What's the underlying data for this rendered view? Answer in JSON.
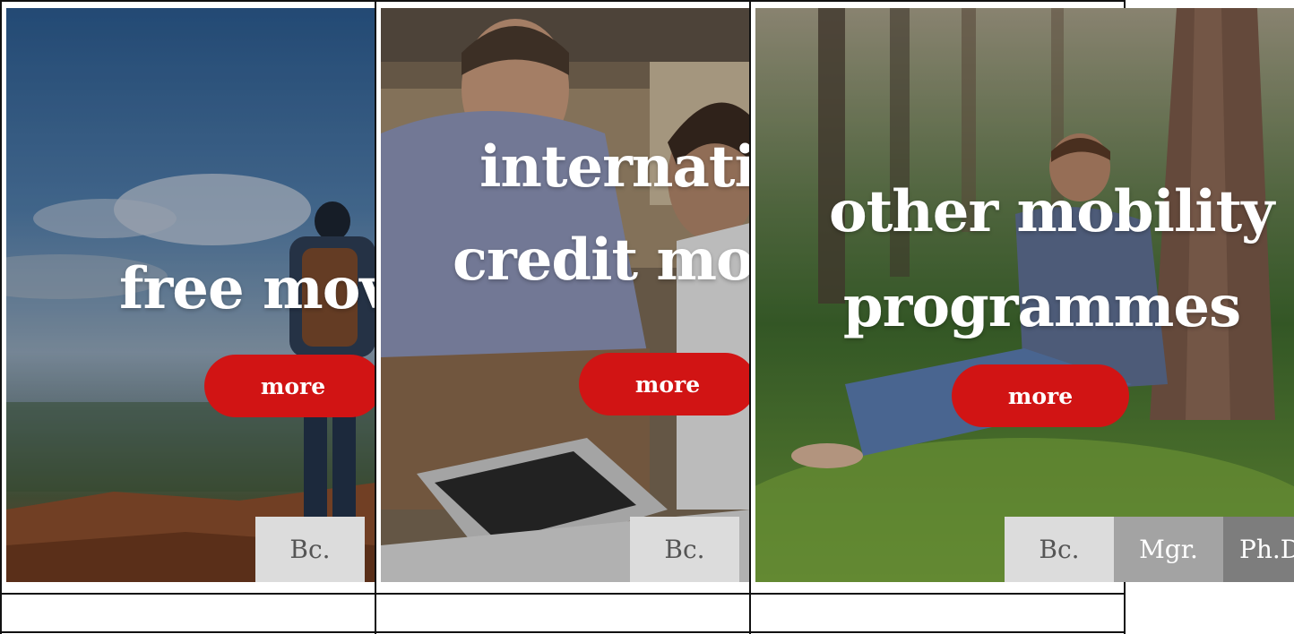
{
  "colors": {
    "accent": "#d11414",
    "tab_bc": "#dcdcdc",
    "tab_mgr": "#a3a3a3",
    "tab_phd": "#7d7d7d"
  },
  "cards": [
    {
      "title_lines": [
        "free mov"
      ],
      "more_label": "more",
      "tabs": [
        "Bc."
      ]
    },
    {
      "title_lines": [
        "internatio",
        "credit mob"
      ],
      "more_label": "more",
      "tabs": [
        "Bc."
      ]
    },
    {
      "title_lines": [
        "other mobility",
        "programmes"
      ],
      "more_label": "more",
      "tabs": [
        "Bc.",
        "Mgr.",
        "Ph.D"
      ]
    }
  ]
}
